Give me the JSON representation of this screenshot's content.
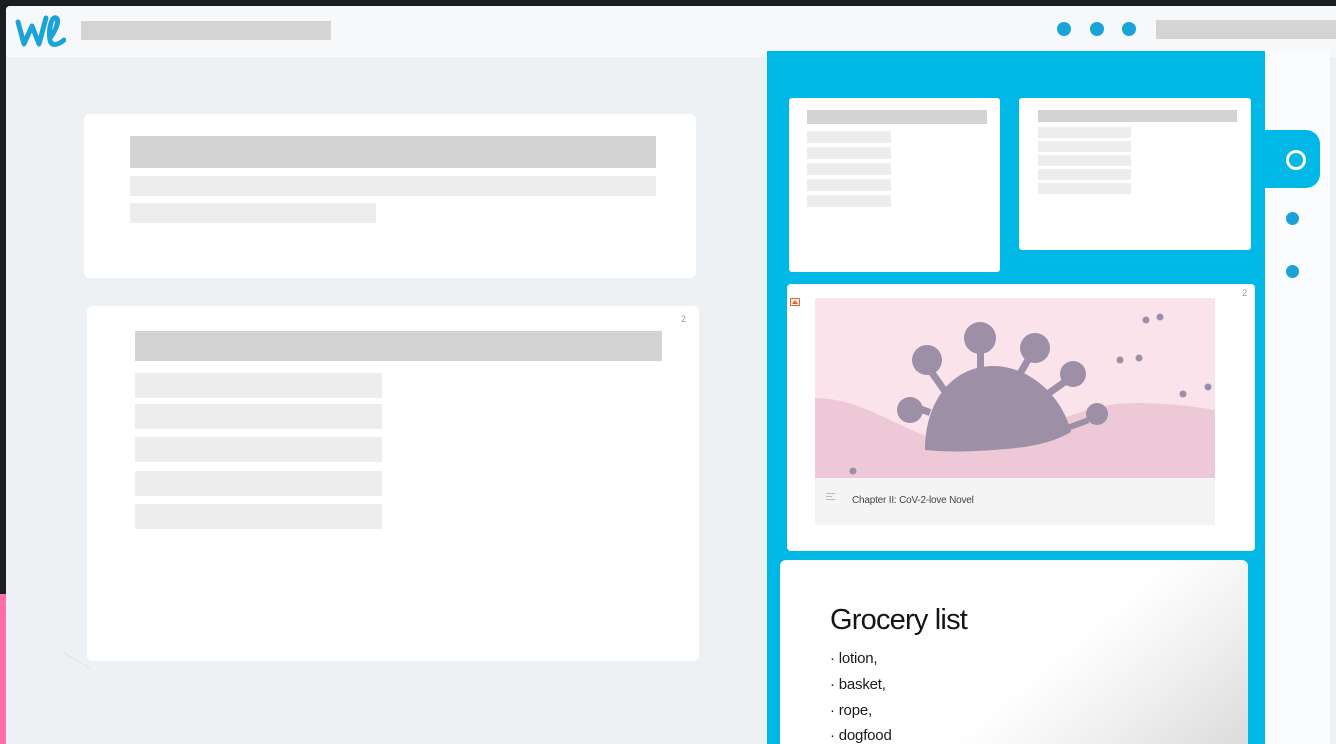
{
  "topbar": {
    "logo": "writing-app-logo-icon",
    "window_dots": [
      "dot-1",
      "dot-2",
      "dot-3"
    ]
  },
  "left_cards": [
    {
      "page_number": ""
    },
    {
      "page_number": "2"
    }
  ],
  "right_panel": {
    "image_card": {
      "page_number": "2",
      "icon": "image-icon",
      "caption": "Chapter II: CoV-2-love Novel",
      "illustration_colors": {
        "background": "#fbe3ec",
        "hill": "#edc8d6",
        "virus": "#9c8fa6"
      }
    },
    "note_card": {
      "title": "Grocery list",
      "items": [
        "· lotion,",
        "· basket,",
        "· rope,",
        "· dogfood"
      ]
    }
  },
  "colors": {
    "accent_blue": "#00b8e6",
    "dot_blue": "#1aa3d8",
    "pink_accent": "#ff6fa8"
  }
}
